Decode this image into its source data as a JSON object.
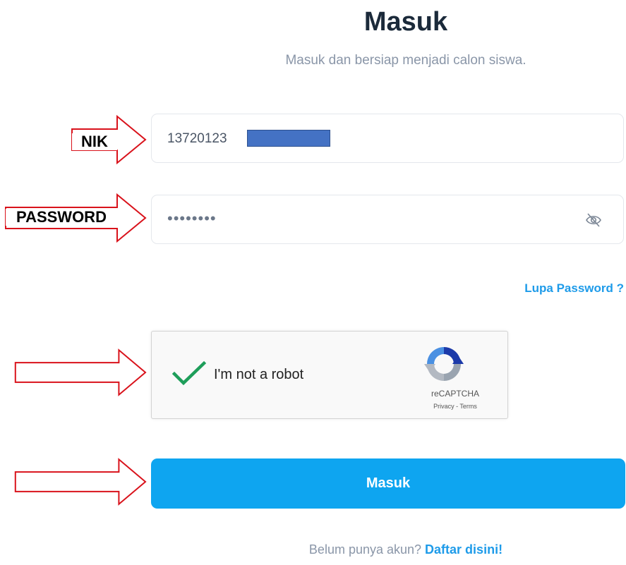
{
  "header": {
    "title": "Masuk",
    "subtitle": "Masuk dan bersiap menjadi calon siswa."
  },
  "form": {
    "nik_value": "13720123",
    "password_masked": "••••••••",
    "forgot_password": "Lupa Password ?",
    "submit_label": "Masuk"
  },
  "recaptcha": {
    "label": "I'm not a robot",
    "brand": "reCAPTCHA",
    "links": "Privacy - Terms"
  },
  "footer": {
    "prompt": "Belum punya akun?",
    "link": "Daftar disini!"
  },
  "annotations": {
    "nik_label": "NIK",
    "password_label": "PASSWORD"
  },
  "colors": {
    "primary": "#0ea5f0",
    "link": "#1e9be9",
    "title": "#1b2a3a",
    "muted": "#8a96a8",
    "annotation_arrow": "#d9121b",
    "check": "#1e9e5a",
    "redaction": "#4472c4"
  }
}
